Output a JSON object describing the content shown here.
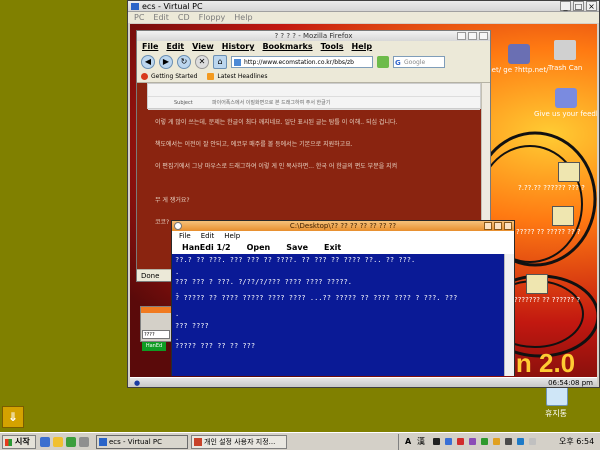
{
  "host_taskbar": {
    "start_label": "시작",
    "tasks": [
      "ecs - Virtual PC",
      "개인 설정 사용자 지정..."
    ],
    "tray_lang": "A",
    "tray_hanja": "漢",
    "clock": "오후 6:54"
  },
  "host_desktop": {
    "recycle_label": "휴지통"
  },
  "vpc": {
    "title": "ecs - Virtual PC",
    "controls": [
      "_",
      "□",
      "×"
    ],
    "menu": [
      "PC",
      "Edit",
      "CD",
      "Floppy",
      "Help"
    ]
  },
  "guest": {
    "icons": {
      "trash_label": "Trash Can",
      "url_label": ".net/ ge ?http.net/",
      "feedback_label": "Give us your feedback !",
      "item1_label": "?.??.?? ?????? ??? ?",
      "item2_label": "????? ?? ????? ?? ?",
      "item3_label": "??????? ?? ?????? ?"
    },
    "clock": "06:54:08 pm",
    "wallpaper_text": "on 2.0"
  },
  "firefox": {
    "title": "? ? ? ? - Mozilla Firefox",
    "menu": [
      "File",
      "Edit",
      "View",
      "History",
      "Bookmarks",
      "Tools",
      "Help"
    ],
    "address": "http://www.ecomstation.co.kr/bbs/zb",
    "search_placeholder": "Google",
    "bookmarks": [
      "Getting Started",
      "Latest Headlines"
    ],
    "form_rows": [
      {
        "label": "Subject",
        "value": "파이어폭스에서 이질화면으로 본 드래그하여 주서 한글기"
      }
    ],
    "paragraphs": [
      "이렇 게 많이 쓰는데, 문제는 한글이 최다 깨지네요. 일단 표시된 글는 탐틀 이 이해.. 되십 겁니다.",
      "책도에서는 이전이 잘 안되고, 에코부 매주를 볼 등에서는 기본으로 지원하고요.",
      "이 편집기에서 그냥 마우스로 드래그하여 이렇 게 인 복사하면... 한국 어 한글의 편도 부분을 지켜",
      "무 게 쟁거요?",
      "코코?"
    ],
    "status": "Done"
  },
  "mini_window": {
    "combo_text": "????",
    "tag_text": "HanEd"
  },
  "hanedi": {
    "title": "C:\\Desktop\\?? ?? ?? ?? ?? ?? ??",
    "menu": [
      "File",
      "Edit",
      "Help"
    ],
    "toolbar": [
      "HanEdi 1/2",
      "Open",
      "Save",
      "Exit"
    ],
    "lines": [
      "??.? ?? ???. ??? ??? ?? ????. ?? ??? ?? ???? ??.. ?? ???.",
      ".",
      "??? ??? ? ???. ?/??/?/??? ???? ???? ?????.",
      ".",
      "? ????? ?? ???? ????? ???? ???? ...?? ????? ?? ???? ???? ? ???. ???",
      ".",
      "??? ????",
      ".",
      "????? ??? ?? ?? ???"
    ]
  }
}
